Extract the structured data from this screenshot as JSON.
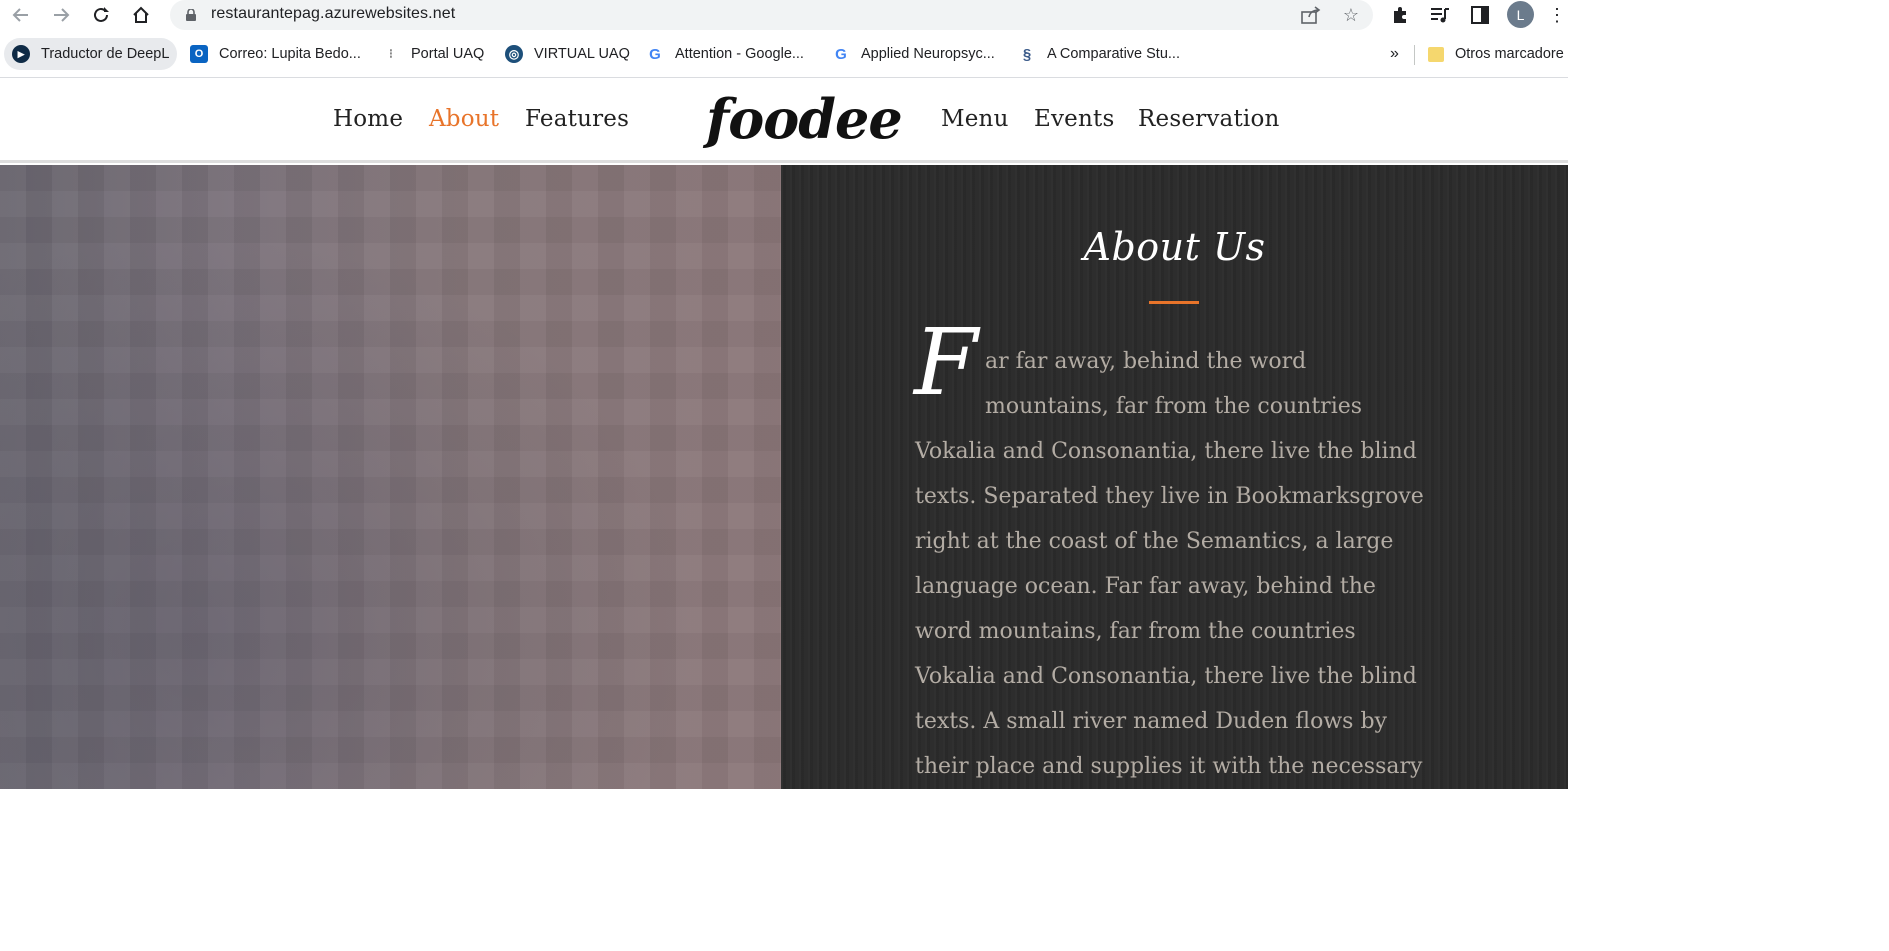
{
  "browser": {
    "url": "restaurantepag.azurewebsites.net",
    "profile_initial": "L",
    "bookmarks": [
      {
        "label": "Traductor de DeepL",
        "icon": "deepl-icon"
      },
      {
        "label": "Correo: Lupita Bedo...",
        "icon": "outlook-icon"
      },
      {
        "label": "Portal UAQ",
        "icon": "portal-icon"
      },
      {
        "label": "VIRTUAL UAQ",
        "icon": "globe-icon"
      },
      {
        "label": "Attention - Google...",
        "icon": "google-icon"
      },
      {
        "label": "Applied Neuropsyc...",
        "icon": "google-icon"
      },
      {
        "label": "A Comparative Stu...",
        "icon": "dna-icon"
      }
    ],
    "overflow": "»",
    "other_bookmarks": "Otros marcadore"
  },
  "site": {
    "logo": "foodee",
    "nav_left": [
      "Home",
      "About",
      "Features"
    ],
    "nav_right": [
      "Menu",
      "Events",
      "Reservation"
    ],
    "active_nav": "About",
    "accent_color": "#e8742a"
  },
  "about": {
    "title": "About Us",
    "dropcap": "F",
    "text": "ar far away, behind the word mountains, far from the countries Vokalia and Consonantia, there live the blind texts. Separated they live in Bookmarksgrove right at the coast of the Semantics, a large language ocean. Far far away, behind the word mountains, far from the countries Vokalia and Consonantia, there live the blind texts. A small river named Duden flows by their place and supplies it with the necessary regelialia. It is a"
  }
}
